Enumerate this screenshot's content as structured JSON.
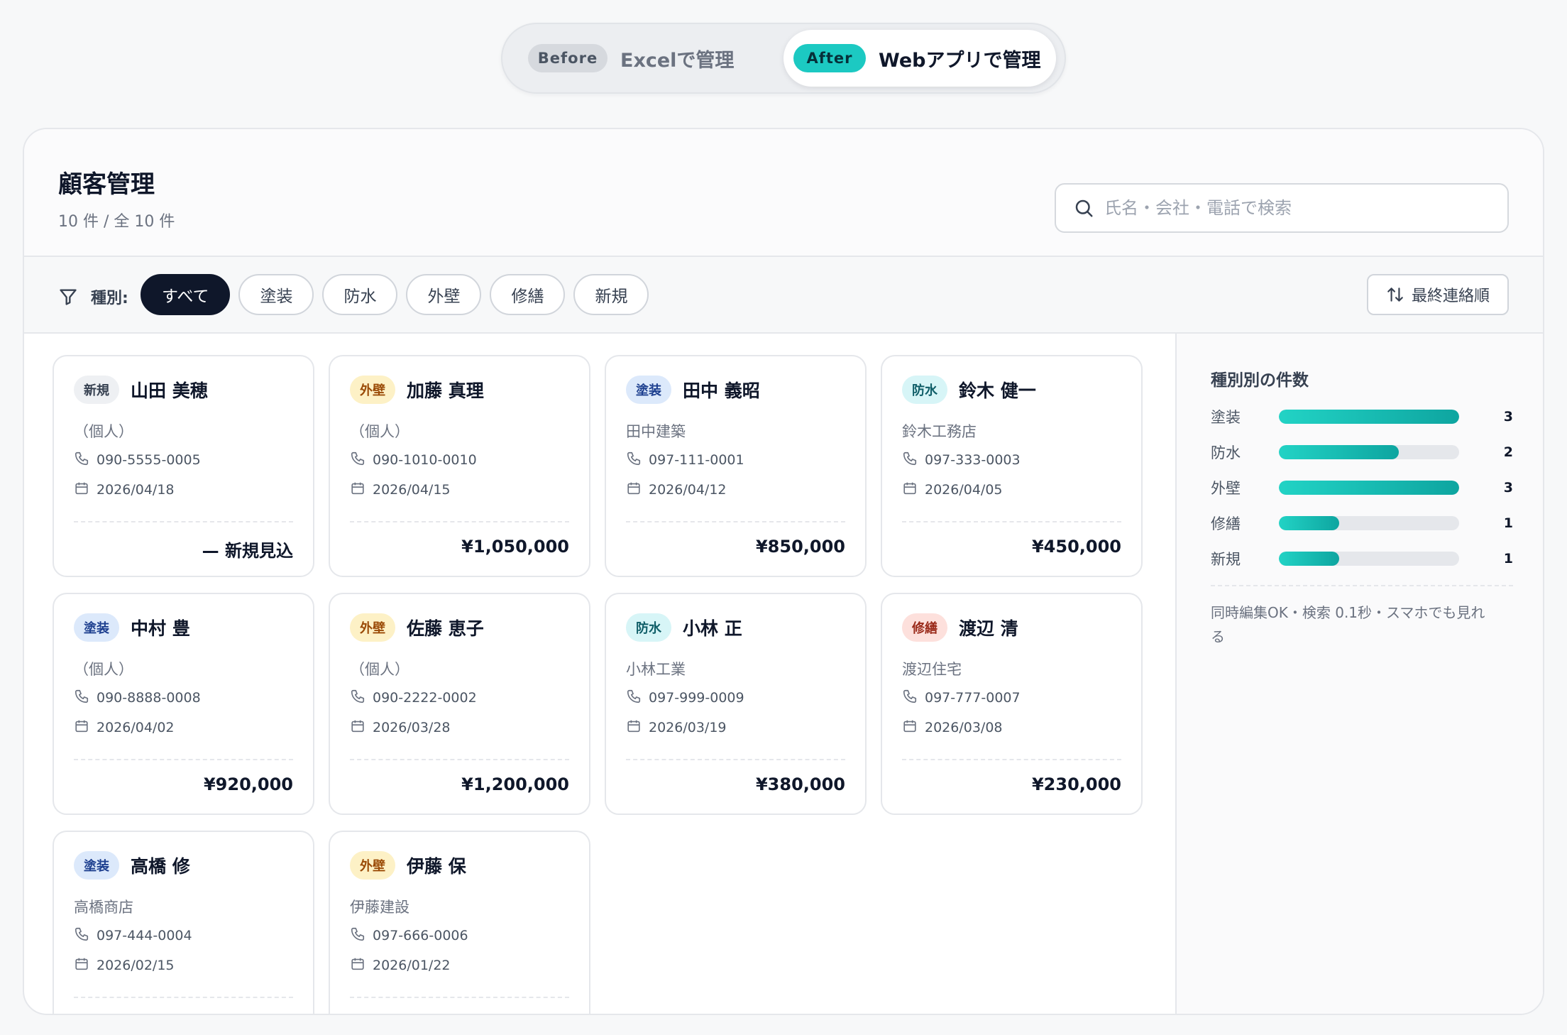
{
  "toggle": {
    "before_badge": "Before",
    "before_text": "Excelで管理",
    "after_badge": "After",
    "after_text": "Webアプリで管理"
  },
  "header": {
    "title": "顧客管理",
    "count": "10 件 / 全 10 件",
    "search_placeholder": "氏名・会社・電話で検索"
  },
  "filter": {
    "label": "種別:",
    "pills": [
      "すべて",
      "塗装",
      "防水",
      "外壁",
      "修繕",
      "新規"
    ],
    "active": "すべて",
    "sort_label": "最終連絡順"
  },
  "tag_colors": {
    "新規": {
      "bg": "#eef0f3",
      "fg": "#374151"
    },
    "外壁": {
      "bg": "#fdf1c6",
      "fg": "#9a4a06"
    },
    "塗装": {
      "bg": "#dce9fb",
      "fg": "#1d3f8f"
    },
    "防水": {
      "bg": "#d7f5f7",
      "fg": "#0f5e68"
    },
    "修繕": {
      "bg": "#fde0dc",
      "fg": "#9a2a1a"
    }
  },
  "customers": [
    {
      "tag": "新規",
      "name": "山田 美穂",
      "company": "（個人）",
      "phone": "090-5555-0005",
      "date": "2026/04/18",
      "amount": "— 新規見込"
    },
    {
      "tag": "外壁",
      "name": "加藤 真理",
      "company": "（個人）",
      "phone": "090-1010-0010",
      "date": "2026/04/15",
      "amount": "¥1,050,000"
    },
    {
      "tag": "塗装",
      "name": "田中 義昭",
      "company": "田中建築",
      "phone": "097-111-0001",
      "date": "2026/04/12",
      "amount": "¥850,000"
    },
    {
      "tag": "防水",
      "name": "鈴木 健一",
      "company": "鈴木工務店",
      "phone": "097-333-0003",
      "date": "2026/04/05",
      "amount": "¥450,000"
    },
    {
      "tag": "塗装",
      "name": "中村 豊",
      "company": "（個人）",
      "phone": "090-8888-0008",
      "date": "2026/04/02",
      "amount": "¥920,000"
    },
    {
      "tag": "外壁",
      "name": "佐藤 恵子",
      "company": "（個人）",
      "phone": "090-2222-0002",
      "date": "2026/03/28",
      "amount": "¥1,200,000"
    },
    {
      "tag": "防水",
      "name": "小林 正",
      "company": "小林工業",
      "phone": "097-999-0009",
      "date": "2026/03/19",
      "amount": "¥380,000"
    },
    {
      "tag": "修繕",
      "name": "渡辺 清",
      "company": "渡辺住宅",
      "phone": "097-777-0007",
      "date": "2026/03/08",
      "amount": "¥230,000"
    },
    {
      "tag": "塗装",
      "name": "高橋 修",
      "company": "高橋商店",
      "phone": "097-444-0004",
      "date": "2026/02/15",
      "amount": ""
    },
    {
      "tag": "外壁",
      "name": "伊藤 保",
      "company": "伊藤建設",
      "phone": "097-666-0006",
      "date": "2026/01/22",
      "amount": ""
    }
  ],
  "sidebar": {
    "title": "種別別の件数",
    "note": "同時編集OK・検索 0.1秒・スマホでも見れる"
  },
  "chart_data": {
    "type": "bar",
    "title": "種別別の件数",
    "categories": [
      "塗装",
      "防水",
      "外壁",
      "修繕",
      "新規"
    ],
    "values": [
      3,
      2,
      3,
      1,
      1
    ],
    "xlim": [
      0,
      3
    ]
  },
  "colors": {
    "accent": "#1cc9c2",
    "dark": "#0f172a"
  }
}
